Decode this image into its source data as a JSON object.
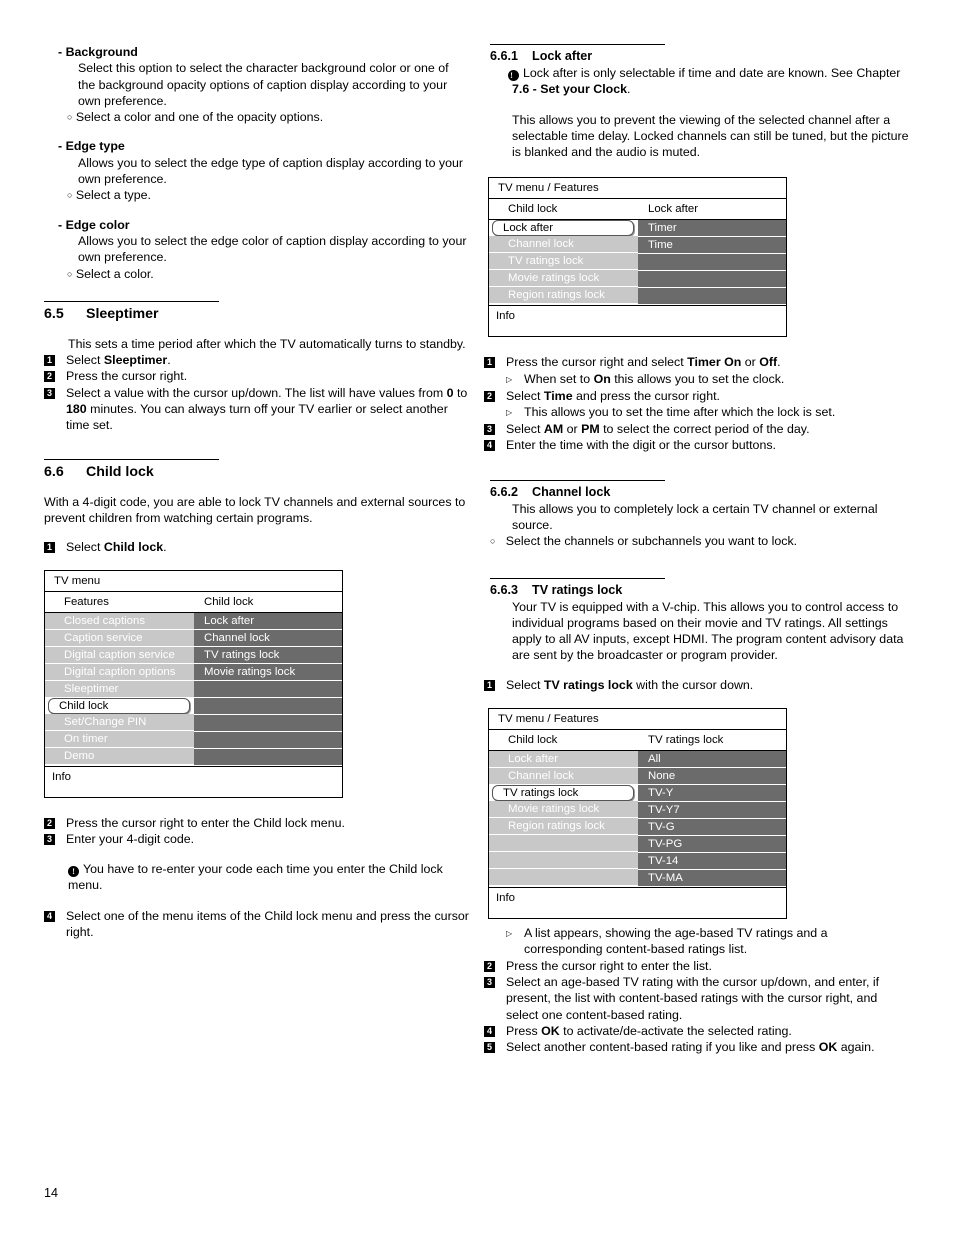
{
  "page": {
    "number": "14"
  },
  "left_column": {
    "option_blocks": [
      {
        "title": "- Background",
        "body": "Select this option to select the character background color or one of the background opacity options of caption display according to your own preference.",
        "bullet": "Select a color and one of the opacity options."
      },
      {
        "title": "- Edge type",
        "body": "Allows you to select the edge type of caption display according to your own preference.",
        "bullet": "Select a type."
      },
      {
        "title": "- Edge color",
        "body": "Allows you to select the edge color of caption display according to your own preference.",
        "bullet": "Select a color."
      }
    ],
    "sleeptimer": {
      "number": "6.5",
      "title": "Sleeptimer",
      "intro": "This sets a time period after which the TV automatically turns to standby.",
      "steps": [
        {
          "n": "1",
          "html": "Select <b>Sleeptimer</b>."
        },
        {
          "n": "2",
          "html": "Press the cursor right."
        },
        {
          "n": "3",
          "html": "Select a value with the cursor up/down. The list will have values from <b>0</b> to <b>180</b> minutes. You can always turn off your TV earlier or select another time set."
        }
      ]
    },
    "childlock": {
      "number": "6.6",
      "title": "Child lock",
      "intro": "With a 4-digit code, you are able to lock TV channels and external sources to prevent children from watching certain programs.",
      "step1": {
        "n": "1",
        "html": "Select <b>Child lock</b>."
      },
      "steps_after": [
        {
          "n": "2",
          "html": "Press the cursor right to enter the Child lock menu."
        },
        {
          "n": "3",
          "html": "Enter your 4-digit code."
        }
      ],
      "note": "You have to re-enter your code each time you enter the Child lock menu.",
      "step4": {
        "n": "4",
        "html": "Select one of the menu items of the Child lock menu and press the cursor right."
      }
    },
    "tv_menu": {
      "title": "TV menu",
      "col1_header": "Features",
      "col2_header": "Child lock",
      "footer": "Info",
      "left_items": [
        {
          "label": "Closed captions",
          "selected": false
        },
        {
          "label": "Caption service",
          "selected": false
        },
        {
          "label": "Digital caption service",
          "selected": false
        },
        {
          "label": "Digital caption options",
          "selected": false
        },
        {
          "label": "Sleeptimer",
          "selected": false
        },
        {
          "label": "Child lock",
          "selected": true
        },
        {
          "label": "Set/Change PIN",
          "selected": false
        },
        {
          "label": "On timer",
          "selected": false
        },
        {
          "label": "Demo",
          "selected": false
        }
      ],
      "right_items": [
        {
          "label": "Lock after"
        },
        {
          "label": "Channel lock"
        },
        {
          "label": "TV ratings lock"
        },
        {
          "label": "Movie ratings lock"
        },
        {
          "label": ""
        },
        {
          "label": ""
        },
        {
          "label": ""
        },
        {
          "label": ""
        },
        {
          "label": ""
        }
      ]
    }
  },
  "right_column": {
    "lock_after": {
      "number": "6.6.1",
      "title": "Lock after",
      "note_html": "Lock after is only selectable if time and date are known. See Chapter <b>7.6 - Set your Clock</b>.",
      "body": "This allows you to prevent the viewing of the selected channel after a selectable time delay. Locked channels can still be tuned, but the picture is blanked and the audio is muted.",
      "steps": [
        {
          "n": "1",
          "html": "Press the cursor right and select <b>Timer On</b> or <b>Off</b>."
        },
        {
          "sub": "When set to <b>On</b> this allows you to set the clock."
        },
        {
          "n": "2",
          "html": "Select <b>Time</b> and press the cursor right."
        },
        {
          "sub": "This allows you to set the time after which the lock is set."
        },
        {
          "n": "3",
          "html": "Select <b>AM</b> or <b>PM</b> to select the correct period of the day."
        },
        {
          "n": "4",
          "html": "Enter the time with the digit or the cursor buttons."
        }
      ]
    },
    "tv_menu_lock_after": {
      "title": "TV menu / Features",
      "col1_header": "Child lock",
      "col2_header": "Lock after",
      "footer": "Info",
      "left_items": [
        {
          "label": "Lock after",
          "selected": true
        },
        {
          "label": "Channel lock",
          "selected": false
        },
        {
          "label": "TV ratings lock",
          "selected": false
        },
        {
          "label": "Movie ratings lock",
          "selected": false
        },
        {
          "label": "Region ratings lock",
          "selected": false
        }
      ],
      "right_items": [
        {
          "label": "Timer"
        },
        {
          "label": "Time"
        },
        {
          "label": ""
        },
        {
          "label": ""
        },
        {
          "label": ""
        }
      ]
    },
    "channel_lock": {
      "number": "6.6.2",
      "title": "Channel lock",
      "body": "This allows you to completely lock a certain TV channel or external source.",
      "bullet": "Select the channels or subchannels you want to lock."
    },
    "tv_ratings_lock": {
      "number": "6.6.3",
      "title": "TV ratings lock",
      "body": "Your TV is equipped with a V-chip. This allows you to control access to individual programs based on their movie and TV ratings. All settings apply to all AV inputs, except HDMI. The program content advisory data are sent by the broadcaster or program provider.",
      "step1": {
        "n": "1",
        "html": "Select <b>TV ratings lock</b> with the cursor down."
      },
      "steps_after": [
        {
          "sub": "A list appears, showing the age-based TV ratings and a corresponding content-based ratings list."
        },
        {
          "n": "2",
          "html": "Press the cursor right to enter the list."
        },
        {
          "n": "3",
          "html": "Select an age-based TV rating with the cursor up/down, and enter, if present, the list with content-based ratings with the cursor right, and select one content-based rating."
        },
        {
          "n": "4",
          "html": "Press <b>OK</b> to activate/de-activate the selected rating."
        },
        {
          "n": "5",
          "html": "Select another content-based rating if you like and press <b>OK</b> again."
        }
      ]
    },
    "tv_menu_ratings": {
      "title": "TV menu / Features",
      "col1_header": "Child lock",
      "col2_header": "TV ratings lock",
      "footer": "Info",
      "left_items": [
        {
          "label": "Lock after",
          "selected": false
        },
        {
          "label": "Channel lock",
          "selected": false
        },
        {
          "label": "TV ratings lock",
          "selected": true
        },
        {
          "label": "Movie ratings lock",
          "selected": false
        },
        {
          "label": "Region ratings lock",
          "selected": false
        },
        {
          "label": "",
          "selected": false
        },
        {
          "label": "",
          "selected": false
        },
        {
          "label": "",
          "selected": false
        }
      ],
      "right_items": [
        {
          "label": "All"
        },
        {
          "label": "None"
        },
        {
          "label": "TV-Y"
        },
        {
          "label": "TV-Y7"
        },
        {
          "label": "TV-G"
        },
        {
          "label": "TV-PG"
        },
        {
          "label": "TV-14"
        },
        {
          "label": "TV-MA"
        }
      ]
    }
  },
  "colors": {
    "menu_left_item_bg": "#c8c8c8",
    "menu_right_item_bg": "#6b6b6b",
    "menu_item_text": "#ffffff",
    "selected_bg": "#ffffff",
    "selected_text": "#000000"
  }
}
